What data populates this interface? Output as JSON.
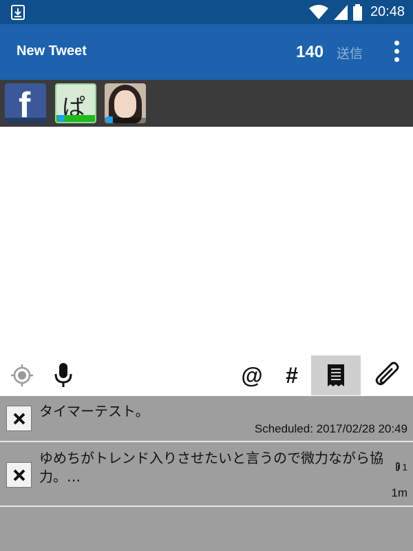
{
  "status_bar": {
    "time": "20:48",
    "icons": [
      "download-icon",
      "wifi-icon",
      "signal-icon",
      "battery-icon"
    ]
  },
  "app_bar": {
    "title": "New Tweet",
    "char_count": "140",
    "send_label": "送信",
    "menu_icon": "more-vert-icon"
  },
  "accounts": [
    {
      "service": "facebook",
      "icon": "facebook-icon",
      "selected": false
    },
    {
      "service": "twitter",
      "avatar_text": "ぱ",
      "selected": true
    },
    {
      "service": "twitter",
      "avatar": "photo",
      "selected": false
    }
  ],
  "compose": {
    "text": ""
  },
  "toolbar": {
    "at_label": "@",
    "hash_label": "#",
    "items": [
      "location-icon",
      "microphone-icon",
      "mention-button",
      "hashtag-button",
      "drafts-icon",
      "attachment-icon"
    ],
    "selected": "drafts-icon"
  },
  "drafts": [
    {
      "text": "タイマーテスト。",
      "meta": "Scheduled: 2017/02/28 20:49"
    },
    {
      "text": "ゆめちがトレンド入りさせたいと言うので微力ながら協力。…",
      "attachments": "1",
      "time": "1m"
    }
  ],
  "colors": {
    "status_bar": "#0f4f8c",
    "app_bar": "#1c62ad",
    "account_strip": "#3b3b3b",
    "drafts_bg": "#9e9e9e",
    "send_disabled": "#8fb3d9"
  }
}
